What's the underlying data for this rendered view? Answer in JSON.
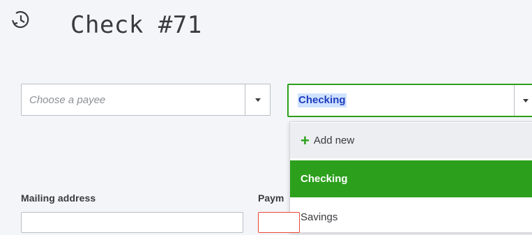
{
  "header": {
    "title": "Check #71",
    "icon": "history-icon"
  },
  "payee": {
    "placeholder": "Choose a payee",
    "value": ""
  },
  "account": {
    "selected": "Checking"
  },
  "dropdown": {
    "add_new_label": "Add new",
    "options": [
      "Checking",
      "Savings"
    ],
    "highlighted": "Checking"
  },
  "form": {
    "mailing_address_label": "Mailing address",
    "payment_label": "Paym"
  },
  "colors": {
    "accent_green": "#2ca01c",
    "error_red": "#e64937",
    "selection_blue": "#1f3cbf"
  }
}
